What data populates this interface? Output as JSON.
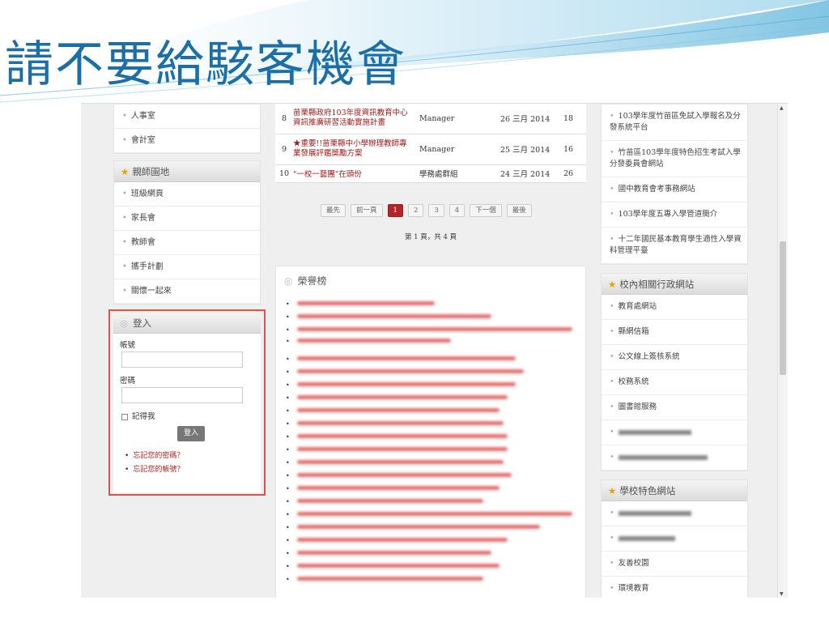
{
  "slide": {
    "title": "請不要給駭客機會",
    "accent": "#1a6fa8"
  },
  "left_sidebar": {
    "top_items": [
      "人事室",
      "會計室"
    ],
    "teacher_panel": {
      "title": "親師園地",
      "items": [
        "班級網頁",
        "家長會",
        "教師會",
        "攜手計劃",
        "關懷一起來"
      ]
    }
  },
  "login": {
    "title": "登入",
    "account_label": "帳號",
    "password_label": "密碼",
    "remember_label": "記得我",
    "button_label": "登入",
    "forgot_password": "忘記您的密碼？",
    "forgot_account": "忘記您的帳號？",
    "highlight_color": "#d9534f"
  },
  "news": {
    "rows": [
      {
        "num": "8",
        "title": "苗栗縣政府103年度資訊教育中心資訊推廣研習活動實施計畫",
        "author": "Manager",
        "date": "26 三月 2014",
        "hits": "18"
      },
      {
        "num": "9",
        "title": "★重要!!苗栗縣中小學辦理教師專業發展評鑑獎勵方案",
        "author": "Manager",
        "date": "25 三月 2014",
        "hits": "16"
      },
      {
        "num": "10",
        "title": "\"一校一藝團\"在頭份",
        "author": "學務處群組",
        "date": "24 三月 2014",
        "hits": "26"
      }
    ],
    "pager": {
      "first": "最先",
      "prev": "前一頁",
      "pages": [
        "1",
        "2",
        "3",
        "4"
      ],
      "current": "1",
      "next": "下一個",
      "last": "最後"
    },
    "page_info": "第 1 頁，共 4 頁"
  },
  "honor": {
    "title": "榮譽榜"
  },
  "right_sidebar": {
    "top_items": [
      "103學年度竹苗區免試入學報名及分發系統平台",
      "竹苗區103學年度特色招生考試入學分發委員會網站",
      "國中教育會考事務網站",
      "103學年度五專入學管道簡介",
      "十二年國民基本教育學生適性入學資料管理平臺"
    ],
    "admin_panel": {
      "title": "校內相關行政網站",
      "items": [
        "教育處網站",
        "縣網信箱",
        "公文線上簽核系統",
        "校務系統",
        "圖書館服務"
      ]
    },
    "feature_panel": {
      "title": "學校特色網站",
      "items": [
        "友善校園",
        "環境教育"
      ]
    }
  }
}
